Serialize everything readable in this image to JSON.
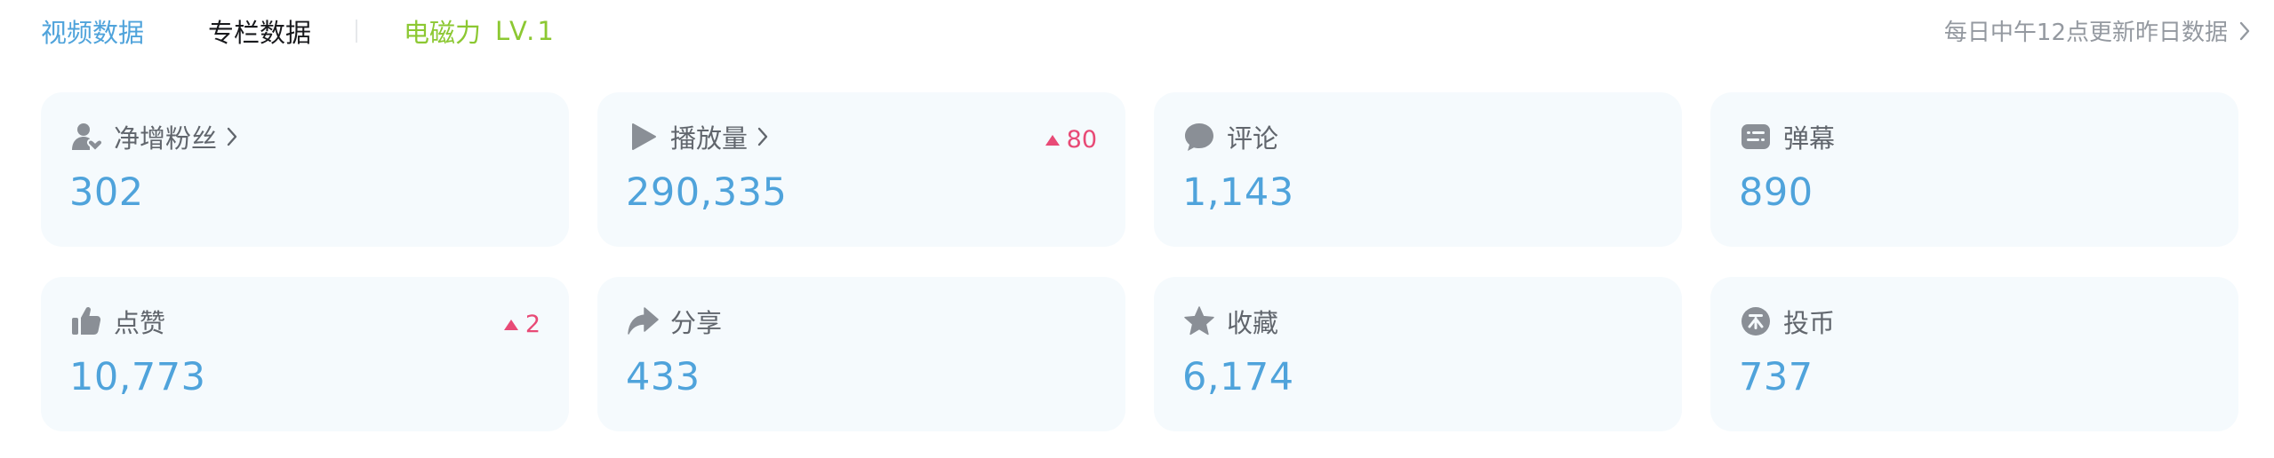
{
  "tabs": [
    {
      "label": "视频数据",
      "active": true
    },
    {
      "label": "专栏数据",
      "active": false
    }
  ],
  "level": {
    "label": "电磁力",
    "value": "LV.1"
  },
  "update_note": "每日中午12点更新昨日数据",
  "colors": {
    "accent": "#4fa3db",
    "level": "#8cc832",
    "increase": "#e84a76",
    "card_bg": "#f5fafd"
  },
  "cards": [
    {
      "label": "净增粉丝",
      "icon": "user-heart-icon",
      "value": "302",
      "has_link": true,
      "delta": ""
    },
    {
      "label": "播放量",
      "icon": "play-icon",
      "value": "290,335",
      "has_link": true,
      "delta": "80"
    },
    {
      "label": "评论",
      "icon": "comment-icon",
      "value": "1,143",
      "has_link": false,
      "delta": ""
    },
    {
      "label": "弹幕",
      "icon": "danmaku-icon",
      "value": "890",
      "has_link": false,
      "delta": ""
    },
    {
      "label": "点赞",
      "icon": "thumb-up-icon",
      "value": "10,773",
      "has_link": false,
      "delta": "2"
    },
    {
      "label": "分享",
      "icon": "share-icon",
      "value": "433",
      "has_link": false,
      "delta": ""
    },
    {
      "label": "收藏",
      "icon": "star-icon",
      "value": "6,174",
      "has_link": false,
      "delta": ""
    },
    {
      "label": "投币",
      "icon": "coin-icon",
      "value": "737",
      "has_link": false,
      "delta": ""
    }
  ]
}
